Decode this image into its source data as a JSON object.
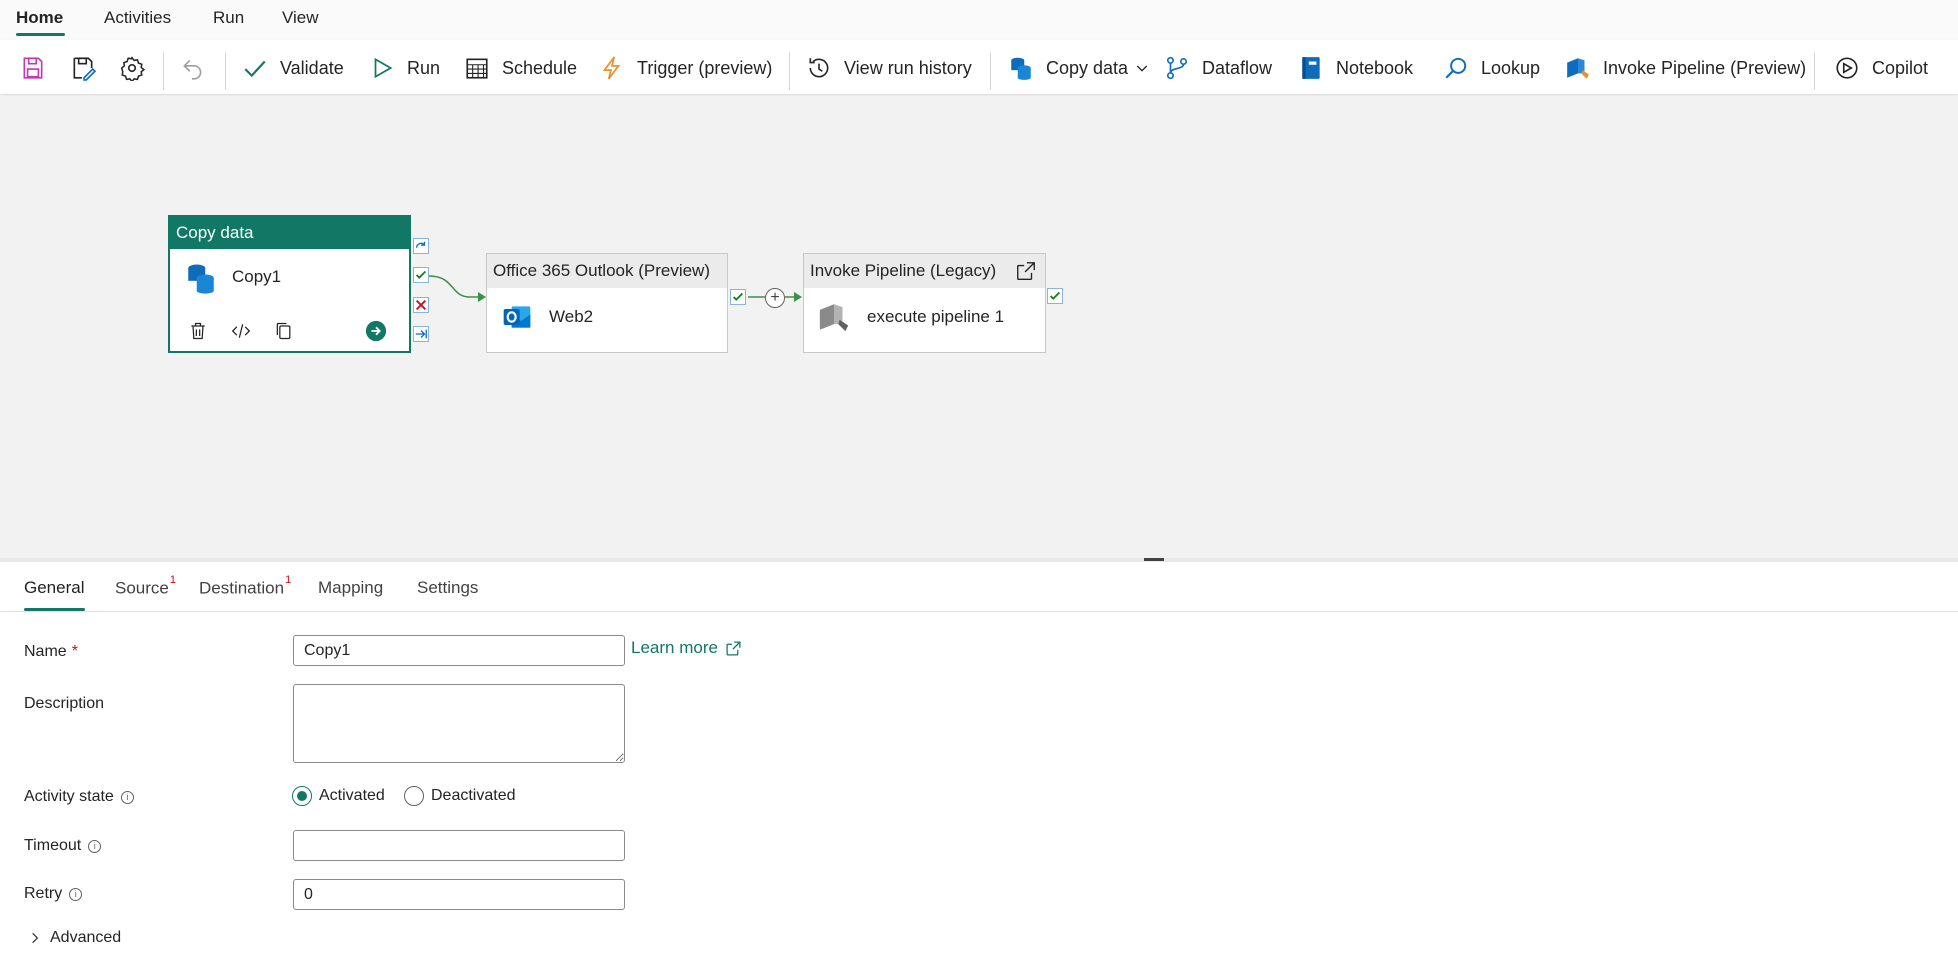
{
  "menu": {
    "tabs": [
      {
        "label": "Home"
      },
      {
        "label": "Activities"
      },
      {
        "label": "Run"
      },
      {
        "label": "View"
      }
    ]
  },
  "toolbar": {
    "validate": "Validate",
    "run": "Run",
    "schedule": "Schedule",
    "trigger": "Trigger (preview)",
    "view_run_history": "View run history",
    "copy_data": "Copy data",
    "dataflow": "Dataflow",
    "notebook": "Notebook",
    "lookup": "Lookup",
    "invoke_pipeline": "Invoke Pipeline (Preview)",
    "copilot": "Copilot"
  },
  "canvas": {
    "copy_activity": {
      "type": "Copy data",
      "name": "Copy1"
    },
    "outlook_activity": {
      "type": "Office 365 Outlook (Preview)",
      "name": "Web2"
    },
    "invoke_activity": {
      "type": "Invoke Pipeline (Legacy)",
      "name": "execute pipeline 1"
    }
  },
  "panel": {
    "tabs": [
      {
        "label": "General"
      },
      {
        "label": "Source",
        "badge": "1"
      },
      {
        "label": "Destination",
        "badge": "1"
      },
      {
        "label": "Mapping"
      },
      {
        "label": "Settings"
      }
    ],
    "fields": {
      "name_label": "Name",
      "name_value": "Copy1",
      "learn_more": "Learn more",
      "description_label": "Description",
      "description_value": "",
      "activity_state_label": "Activity state",
      "activated": "Activated",
      "deactivated": "Deactivated",
      "timeout_label": "Timeout",
      "timeout_value": "",
      "retry_label": "Retry",
      "retry_value": "0",
      "advanced": "Advanced"
    }
  },
  "colors": {
    "accent": "#117865",
    "canvas_bg": "#f2f2f2",
    "required": "#c50f1f"
  }
}
